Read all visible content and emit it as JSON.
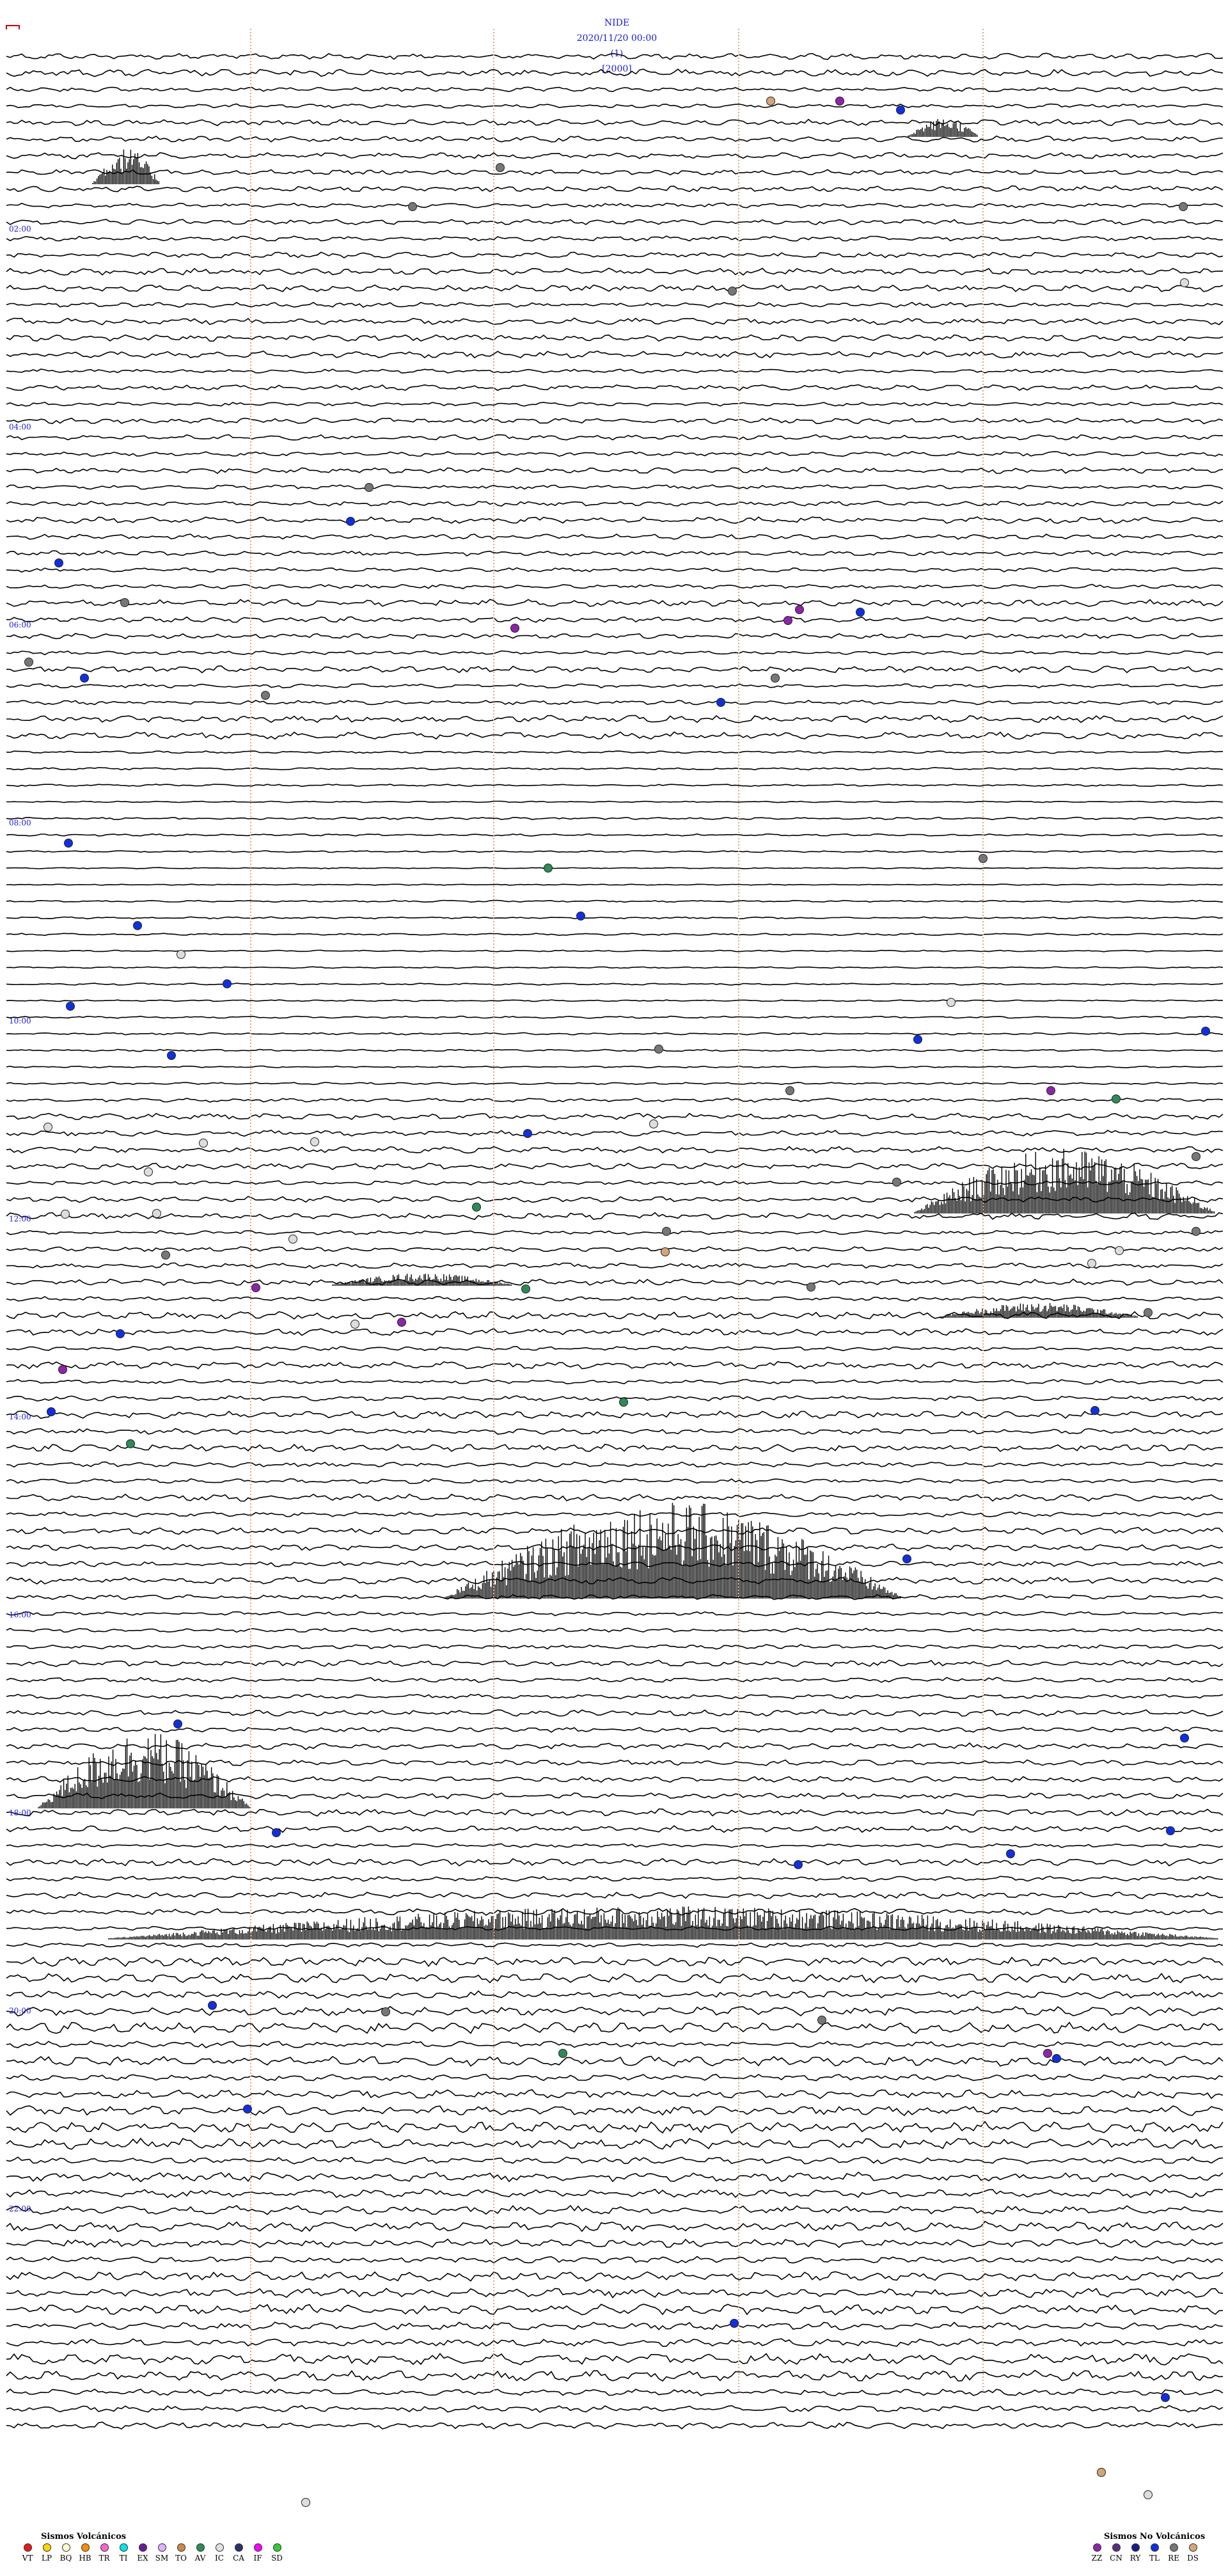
{
  "header": {
    "station": "NIDE",
    "datetime": "2020/11/20 00:00",
    "component": "(1)",
    "gain": "[2000]"
  },
  "time_labels": [
    "02:00",
    "04:00",
    "06:00",
    "08:00",
    "10:00",
    "12:00",
    "14:00",
    "16:00",
    "18:00",
    "20:00",
    "22:00"
  ],
  "legend_volcanic": {
    "title": "Sismos Volcánicos",
    "items": [
      {
        "code": "VT",
        "color": "#e31a1c"
      },
      {
        "code": "LP",
        "color": "#ffd400"
      },
      {
        "code": "BQ",
        "color": "#ffffcc"
      },
      {
        "code": "HB",
        "color": "#ff8c00"
      },
      {
        "code": "TR",
        "color": "#ff66cc"
      },
      {
        "code": "TI",
        "color": "#00e5ee"
      },
      {
        "code": "EX",
        "color": "#6a1b9a"
      },
      {
        "code": "SM",
        "color": "#e0b0ff"
      },
      {
        "code": "TO",
        "color": "#cc8844"
      },
      {
        "code": "AV",
        "color": "#2e8b57"
      },
      {
        "code": "IC",
        "color": "#e0e0e0"
      },
      {
        "code": "CA",
        "color": "#2f2f6f"
      },
      {
        "code": "IF",
        "color": "#ff00ff"
      },
      {
        "code": "SD",
        "color": "#33cc33"
      }
    ]
  },
  "legend_nonvolcanic": {
    "title": "Sismos No Volcánicos",
    "items": [
      {
        "code": "ZZ",
        "color": "#8e24aa"
      },
      {
        "code": "CN",
        "color": "#5b2d82"
      },
      {
        "code": "RY",
        "color": "#1a1a8c"
      },
      {
        "code": "TL",
        "color": "#1030e0"
      },
      {
        "code": "RE",
        "color": "#777777"
      },
      {
        "code": "DS",
        "color": "#d2a679"
      }
    ]
  }
}
